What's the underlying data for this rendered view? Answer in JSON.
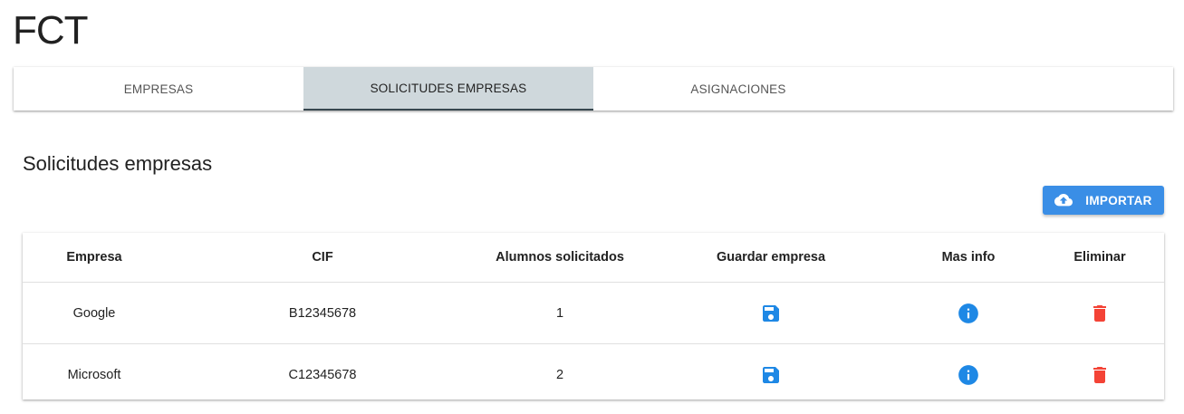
{
  "app": {
    "title": "FCT"
  },
  "tabs": [
    {
      "label": "EMPRESAS",
      "active": false
    },
    {
      "label": "SOLICITUDES EMPRESAS",
      "active": true
    },
    {
      "label": "ASIGNACIONES",
      "active": false
    }
  ],
  "section": {
    "title": "Solicitudes empresas",
    "import_label": "IMPORTAR",
    "import_icon": "cloud-upload-icon"
  },
  "table": {
    "columns": [
      "Empresa",
      "CIF",
      "Alumnos solicitados",
      "Guardar empresa",
      "Mas info",
      "Eliminar"
    ],
    "rows": [
      {
        "empresa": "Google",
        "cif": "B12345678",
        "alumnos": "1"
      },
      {
        "empresa": "Microsoft",
        "cif": "C12345678",
        "alumnos": "2"
      }
    ],
    "icons": {
      "save": "save-icon",
      "info": "info-icon",
      "delete": "trash-icon"
    }
  },
  "colors": {
    "active_tab_bg": "#cfd8dc",
    "active_tab_indicator": "#37474f",
    "import_button": "#3a8ee6",
    "save_icon": "#1e88e5",
    "info_icon": "#1e88e5",
    "delete_icon": "#f44336"
  }
}
